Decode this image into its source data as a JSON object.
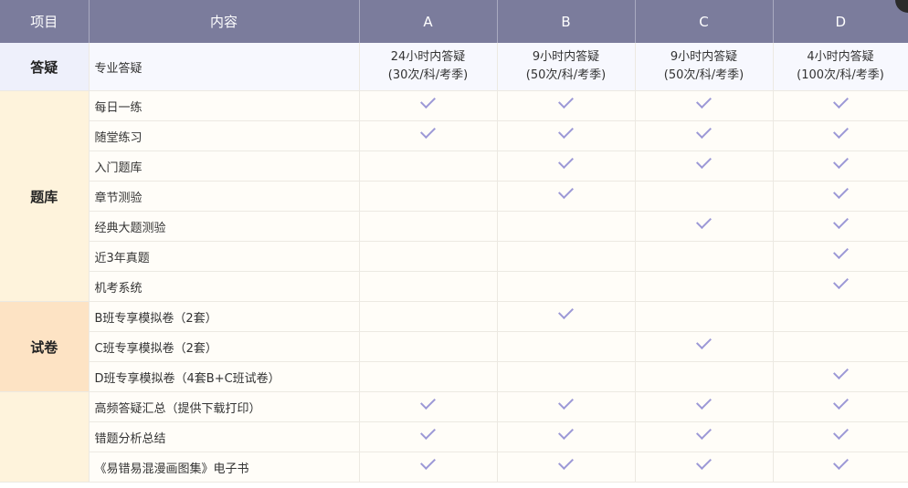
{
  "headers": {
    "project": "项目",
    "content": "内容",
    "a": "A",
    "b": "B",
    "c": "C",
    "d": "D"
  },
  "qa": {
    "category": "答疑",
    "content": "专业答疑",
    "a": [
      "24小时内答疑",
      "(30次/科/考季)"
    ],
    "b": [
      "9小时内答疑",
      "(50次/科/考季)"
    ],
    "c": [
      "9小时内答疑",
      "(50次/科/考季)"
    ],
    "d": [
      "4小时内答疑",
      "(100次/科/考季)"
    ]
  },
  "groups": [
    {
      "category": "题库",
      "rows": [
        {
          "content": "每日一练",
          "checks": [
            true,
            true,
            true,
            true
          ]
        },
        {
          "content": "随堂练习",
          "checks": [
            true,
            true,
            true,
            true
          ]
        },
        {
          "content": "入门题库",
          "checks": [
            false,
            true,
            true,
            true
          ]
        },
        {
          "content": "章节测验",
          "checks": [
            false,
            true,
            false,
            true
          ]
        },
        {
          "content": "经典大题测验",
          "checks": [
            false,
            false,
            true,
            true
          ]
        },
        {
          "content": "近3年真题",
          "checks": [
            false,
            false,
            false,
            true
          ]
        },
        {
          "content": "机考系统",
          "checks": [
            false,
            false,
            false,
            true
          ]
        }
      ]
    },
    {
      "category": "试卷",
      "rows": [
        {
          "content": "B班专享模拟卷（2套）",
          "checks": [
            false,
            true,
            false,
            false
          ]
        },
        {
          "content": "C班专享模拟卷（2套）",
          "checks": [
            false,
            false,
            true,
            false
          ]
        },
        {
          "content": "D班专享模拟卷（4套B+C班试卷）",
          "checks": [
            false,
            false,
            false,
            true
          ]
        }
      ]
    },
    {
      "category": "",
      "rows": [
        {
          "content": "高频答疑汇总（提供下载打印）",
          "checks": [
            true,
            true,
            true,
            true
          ]
        },
        {
          "content": "错题分析总结",
          "checks": [
            true,
            true,
            true,
            true
          ]
        },
        {
          "content": "《易错易混漫画图集》电子书",
          "checks": [
            true,
            true,
            true,
            true
          ]
        }
      ]
    }
  ],
  "colors": {
    "header": "#7b7c9c",
    "check": "#9c98d6",
    "qa_bg": "#eef0fb",
    "tiku_bg": "#fef3dc",
    "shijuan_bg": "#fde3c4",
    "other_bg": "#fef3dc",
    "row_bg": "#fffdf8"
  }
}
